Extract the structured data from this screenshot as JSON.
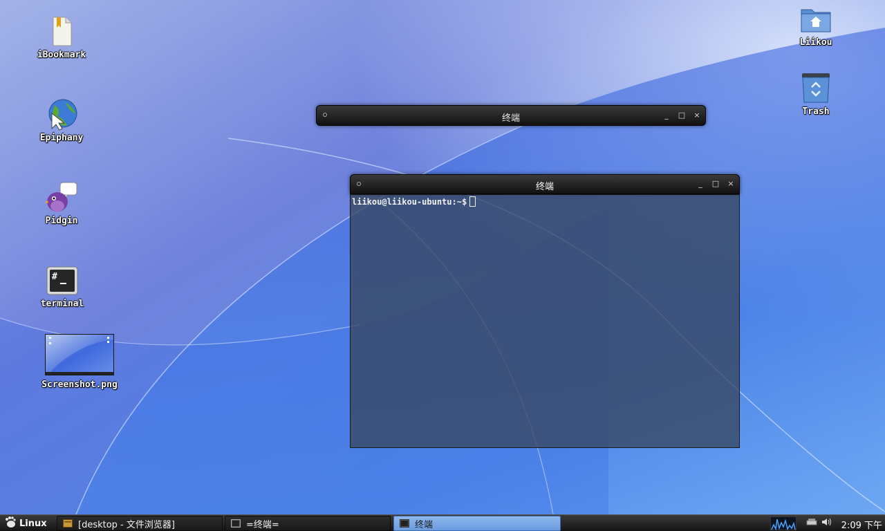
{
  "desktop": {
    "icons_left": [
      {
        "label": "iBookmark",
        "icon": "bookmark-file-icon"
      },
      {
        "label": "Epiphany",
        "icon": "globe-browser-icon"
      },
      {
        "label": "Pidgin",
        "icon": "pidgin-bird-icon"
      },
      {
        "label": "terminal",
        "icon": "terminal-icon"
      },
      {
        "label": "Screenshot.png",
        "icon": "image-thumbnail-icon"
      }
    ],
    "icons_right": [
      {
        "label": "Liikou",
        "icon": "home-folder-icon"
      },
      {
        "label": "Trash",
        "icon": "trash-icon"
      }
    ]
  },
  "windows": {
    "collapsed": {
      "title": "终端",
      "minimize": "_",
      "maximize": "□",
      "close": "×"
    },
    "terminal": {
      "title": "终端",
      "minimize": "_",
      "maximize": "□",
      "close": "×",
      "prompt": "liikou@liikou-ubuntu:~$"
    }
  },
  "taskbar": {
    "start_label": "Linux",
    "tasks": [
      {
        "label": "[desktop - 文件浏览器]",
        "icon": "file-manager-icon",
        "active": false
      },
      {
        "label": "=终端=",
        "icon": "terminal-small-icon",
        "active": false
      },
      {
        "label": "终端",
        "icon": "terminal-small-icon",
        "active": true
      }
    ],
    "clock": "2:09 下午"
  },
  "colors": {
    "wallpaper_light": "#bcd0f5",
    "wallpaper_mid": "#6a88e0",
    "wallpaper_deep": "#2a55d8",
    "active_task": "#7aa9e6",
    "terminal_bg": "#37465f"
  }
}
